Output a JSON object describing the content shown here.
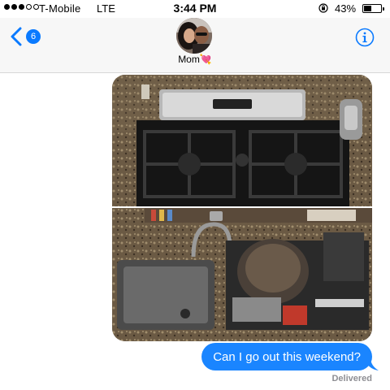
{
  "status_bar": {
    "carrier": "T-Mobile",
    "network": "LTE",
    "time": "3:44 PM",
    "battery": "43%",
    "battery_level": 0.43,
    "signal_bars_filled": 3,
    "signal_bars_total": 5
  },
  "header": {
    "back_icon": "chevron-left-icon",
    "unread_count": "6",
    "contact_name": "Mom💘",
    "info_icon": "info-icon",
    "accent_color": "#0a7aff"
  },
  "conversation": {
    "attachments": [
      {
        "kind": "photo",
        "subject": "stove"
      },
      {
        "kind": "photo",
        "subject": "sink"
      }
    ],
    "outgoing_message": "Can I go out this weekend?",
    "bubble_color": "#1a85ff",
    "delivery_status": "Delivered"
  }
}
